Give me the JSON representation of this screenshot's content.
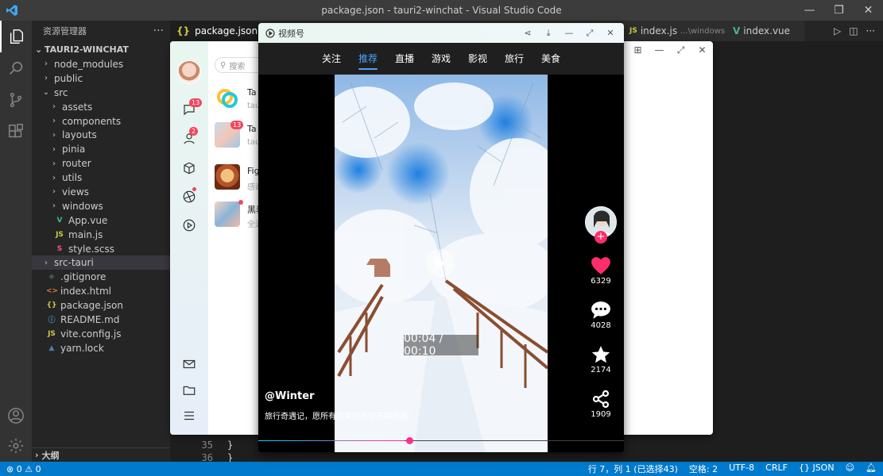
{
  "vscode": {
    "window_title": "package.json - tauri2-winchat - Visual Studio Code",
    "explorer_header": "资源管理器",
    "explorer_more": "···",
    "root_folder": "TAURI2-WINCHAT",
    "tree": [
      {
        "label": "node_modules",
        "type": "folder"
      },
      {
        "label": "public",
        "type": "folder"
      },
      {
        "label": "src",
        "type": "folder-open"
      },
      {
        "label": "assets",
        "type": "folder"
      },
      {
        "label": "components",
        "type": "folder"
      },
      {
        "label": "layouts",
        "type": "folder"
      },
      {
        "label": "pinia",
        "type": "folder"
      },
      {
        "label": "router",
        "type": "folder"
      },
      {
        "label": "utils",
        "type": "folder"
      },
      {
        "label": "views",
        "type": "folder"
      },
      {
        "label": "windows",
        "type": "folder"
      },
      {
        "label": "App.vue",
        "type": "vue"
      },
      {
        "label": "main.js",
        "type": "js"
      },
      {
        "label": "style.scss",
        "type": "scss"
      },
      {
        "label": "src-tauri",
        "type": "folder"
      },
      {
        "label": ".gitignore",
        "type": "git"
      },
      {
        "label": "index.html",
        "type": "html"
      },
      {
        "label": "package.json",
        "type": "json"
      },
      {
        "label": "README.md",
        "type": "md"
      },
      {
        "label": "vite.config.js",
        "type": "js"
      },
      {
        "label": "yarn.lock",
        "type": "lock"
      }
    ],
    "outline_label": "大纲",
    "tabs": [
      {
        "label": "package.json",
        "icon": "{}"
      },
      {
        "label": "index.js",
        "detail": "...\\windows",
        "icon": "JS"
      },
      {
        "label": "index.vue",
        "icon": "V"
      }
    ],
    "line_numbers": [
      "35",
      "36"
    ],
    "code_lines": [
      "  }",
      "}"
    ],
    "status_left": "⊗ 0 ⚠ 0",
    "status_right": [
      "行 7，列 1 (已选择43)",
      "空格: 2",
      "UTF-8",
      "CRLF",
      "{} JSON"
    ]
  },
  "chat_app": {
    "search_placeholder": "搜索",
    "badges": {
      "messages": "13",
      "contacts": "2",
      "group": "13"
    },
    "chats": [
      {
        "name": "Ta",
        "sub": "tau"
      },
      {
        "name": "Ta",
        "sub": "tau"
      },
      {
        "name": "Fig",
        "sub": "感谢"
      },
      {
        "name": "黑表",
        "sub": "全涵"
      }
    ]
  },
  "player": {
    "title": "视频号",
    "categories": [
      "关注",
      "推荐",
      "直播",
      "游戏",
      "影视",
      "旅行",
      "美食"
    ],
    "active_category": "推荐",
    "time": "00:04 / 00:10",
    "author": "@Winter",
    "caption": "旅行奇遇记，愿所有的美好与你不期而遇!",
    "likes": "6329",
    "comments": "4028",
    "favorites": "2174",
    "shares": "1909",
    "progress": 0.4,
    "colors": {
      "accent": "#4aa3ff",
      "like": "#ff2d6b",
      "brand": "#007acc"
    }
  }
}
